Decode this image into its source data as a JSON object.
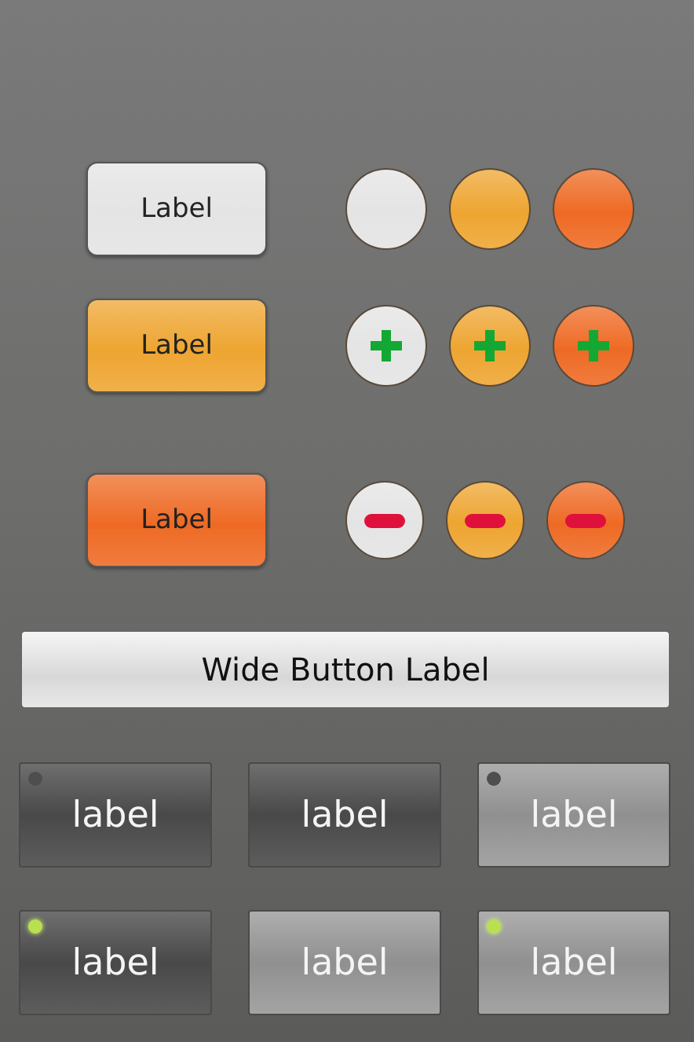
{
  "button_rows": [
    {
      "label": "Label",
      "color": "#e4e4e4",
      "round_buttons": [
        {
          "color": "#e4e4e4",
          "kind": "plain"
        },
        {
          "color": "#eea531",
          "kind": "plain"
        },
        {
          "color": "#ee6a24",
          "kind": "plain"
        }
      ]
    },
    {
      "label": "Label",
      "color": "#eea531",
      "round_buttons": [
        {
          "color": "#e4e4e4",
          "kind": "plus"
        },
        {
          "color": "#eea531",
          "kind": "plus"
        },
        {
          "color": "#ee6a24",
          "kind": "plus"
        }
      ]
    },
    {
      "label": "Label",
      "color": "#ee6a24",
      "round_buttons": [
        {
          "color": "#e4e4e4",
          "kind": "minus"
        },
        {
          "color": "#eea531",
          "kind": "minus"
        },
        {
          "color": "#ee6a24",
          "kind": "minus"
        }
      ]
    }
  ],
  "wide_button": {
    "label": "Wide Button Label"
  },
  "tiles": [
    {
      "label": "label",
      "color": "#4f4f4f",
      "kind": "indicator",
      "on": false
    },
    {
      "label": "label",
      "color": "#4f4f4f",
      "kind": "plain"
    },
    {
      "label": "label",
      "color": "#9c9c9c",
      "kind": "indicator",
      "on": false
    },
    {
      "label": "label",
      "color": "#4f4f4f",
      "kind": "indicator",
      "on": true
    },
    {
      "label": "label",
      "color": "#9c9c9c",
      "kind": "plain"
    },
    {
      "label": "label",
      "color": "#9c9c9c",
      "kind": "indicator",
      "on": true
    }
  ]
}
